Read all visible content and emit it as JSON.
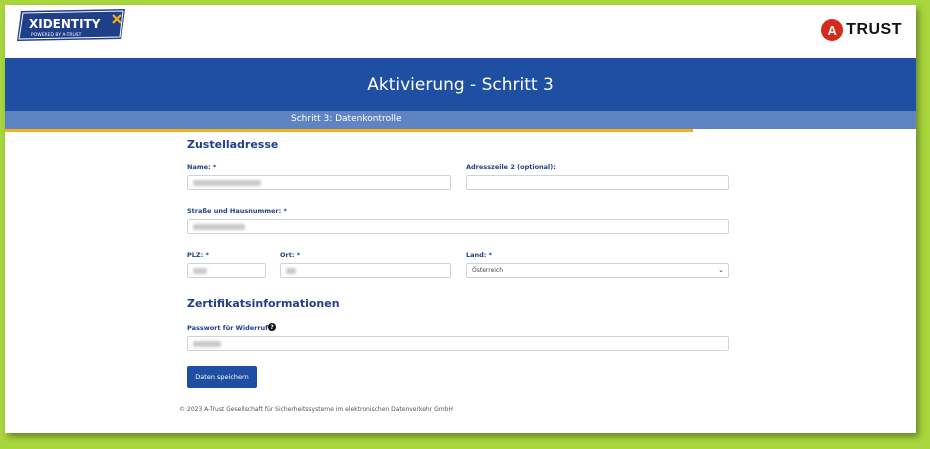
{
  "header": {
    "xidentity_logo": "XIDENTITY",
    "xidentity_tagline": "POWERED BY A-TRUST",
    "atrust_logo_mark": "A",
    "atrust_logo_text": "TRUST"
  },
  "banner": {
    "title": "Aktivierung - Schritt 3"
  },
  "progress": {
    "label": "Schritt 3: Datenkontrolle",
    "fraction": 0.755
  },
  "address": {
    "section_title": "Zustelladresse",
    "name_label": "Name: *",
    "address2_label": "Adresszeile 2 (optional):",
    "street_label": "Straße und Hausnummer: *",
    "zip_label": "PLZ: *",
    "city_label": "Ort: *",
    "country_label": "Land: *",
    "country_value": "Österreich"
  },
  "certificate": {
    "section_title": "Zertifikatsinformationen",
    "password_label": "Passwort für Widerruf: *",
    "help_glyph": "?"
  },
  "actions": {
    "save_label": "Daten speichern"
  },
  "footer": {
    "copyright_symbol": "©",
    "text": "2023 A-Trust Gesellschaft für Sicherheitssysteme im elektronischen Datenverkehr GmbH"
  },
  "colors": {
    "primary": "#1f4fa3",
    "progress_bg": "#5f84c1",
    "progress_fill": "#f0b21a",
    "border": "#a8d63c",
    "atrust_red": "#d52b1e"
  }
}
